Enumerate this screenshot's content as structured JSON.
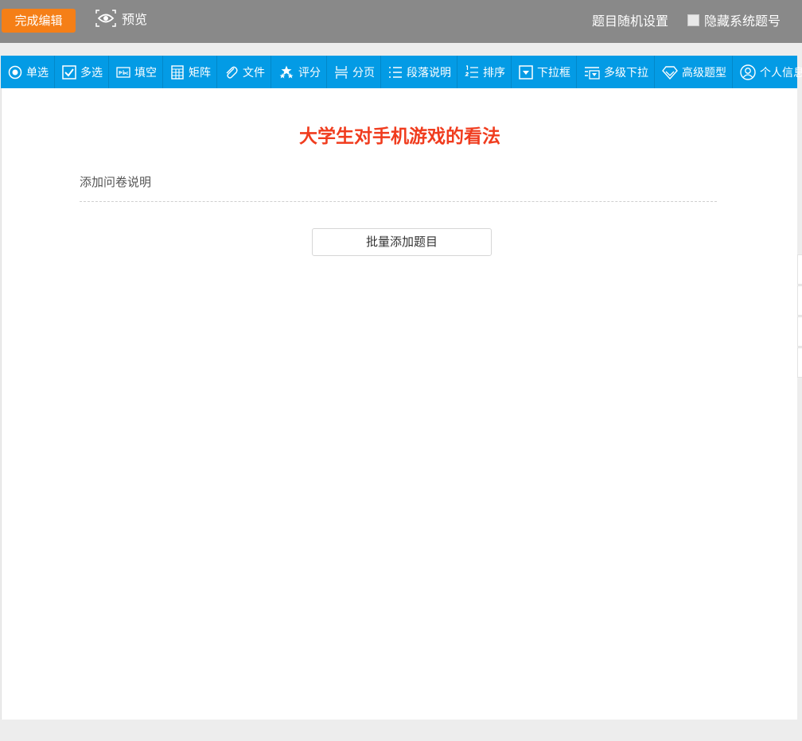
{
  "header": {
    "finish_label": "完成编辑",
    "preview_label": "预览",
    "random_setting_label": "题目随机设置",
    "hide_number_label": "隐藏系统题号",
    "hide_number_checked": false
  },
  "toolbar": {
    "items": [
      {
        "label": "单选",
        "icon": "radio-icon"
      },
      {
        "label": "多选",
        "icon": "checkbox-icon"
      },
      {
        "label": "填空",
        "icon": "fill-blank-icon"
      },
      {
        "label": "矩阵",
        "icon": "matrix-icon"
      },
      {
        "label": "文件",
        "icon": "paperclip-icon"
      },
      {
        "label": "评分",
        "icon": "stars-icon"
      },
      {
        "label": "分页",
        "icon": "page-break-icon"
      },
      {
        "label": "段落说明",
        "icon": "paragraph-icon"
      },
      {
        "label": "排序",
        "icon": "sort-icon"
      },
      {
        "label": "下拉框",
        "icon": "dropdown-icon"
      },
      {
        "label": "多级下拉",
        "icon": "multi-dropdown-icon"
      },
      {
        "label": "高级题型",
        "icon": "diamond-icon"
      },
      {
        "label": "个人信息",
        "icon": "user-icon"
      }
    ]
  },
  "survey": {
    "title": "大学生对手机游戏的看法",
    "description_placeholder": "添加问卷说明",
    "batch_add_label": "批量添加题目"
  },
  "colors": {
    "topbar": "#898989",
    "accent_orange": "#f57f17",
    "toolbar_blue": "#039be5",
    "title_red": "#f03c1e"
  }
}
